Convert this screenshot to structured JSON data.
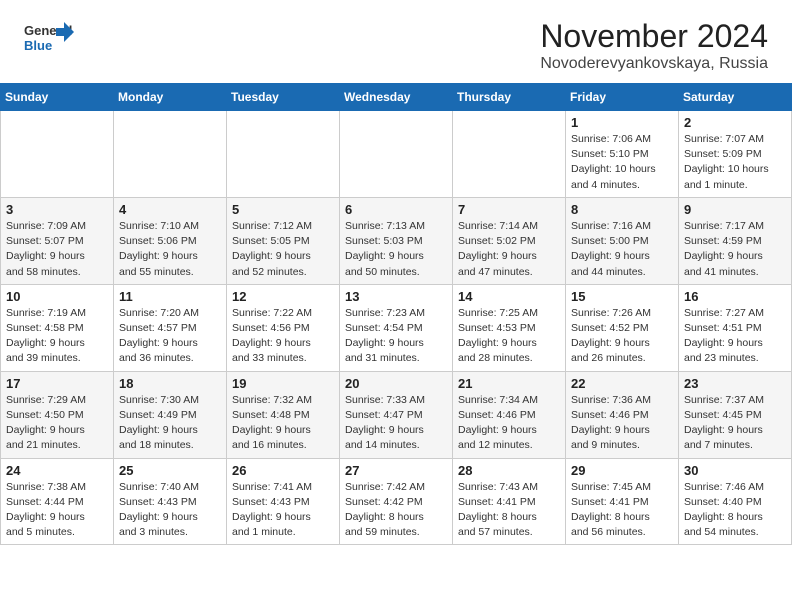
{
  "header": {
    "logo_line1": "General",
    "logo_line2": "Blue",
    "title": "November 2024",
    "subtitle": "Novoderevyankovskaya, Russia"
  },
  "days_of_week": [
    "Sunday",
    "Monday",
    "Tuesday",
    "Wednesday",
    "Thursday",
    "Friday",
    "Saturday"
  ],
  "weeks": [
    [
      {
        "day": "",
        "info": ""
      },
      {
        "day": "",
        "info": ""
      },
      {
        "day": "",
        "info": ""
      },
      {
        "day": "",
        "info": ""
      },
      {
        "day": "",
        "info": ""
      },
      {
        "day": "1",
        "info": "Sunrise: 7:06 AM\nSunset: 5:10 PM\nDaylight: 10 hours\nand 4 minutes."
      },
      {
        "day": "2",
        "info": "Sunrise: 7:07 AM\nSunset: 5:09 PM\nDaylight: 10 hours\nand 1 minute."
      }
    ],
    [
      {
        "day": "3",
        "info": "Sunrise: 7:09 AM\nSunset: 5:07 PM\nDaylight: 9 hours\nand 58 minutes."
      },
      {
        "day": "4",
        "info": "Sunrise: 7:10 AM\nSunset: 5:06 PM\nDaylight: 9 hours\nand 55 minutes."
      },
      {
        "day": "5",
        "info": "Sunrise: 7:12 AM\nSunset: 5:05 PM\nDaylight: 9 hours\nand 52 minutes."
      },
      {
        "day": "6",
        "info": "Sunrise: 7:13 AM\nSunset: 5:03 PM\nDaylight: 9 hours\nand 50 minutes."
      },
      {
        "day": "7",
        "info": "Sunrise: 7:14 AM\nSunset: 5:02 PM\nDaylight: 9 hours\nand 47 minutes."
      },
      {
        "day": "8",
        "info": "Sunrise: 7:16 AM\nSunset: 5:00 PM\nDaylight: 9 hours\nand 44 minutes."
      },
      {
        "day": "9",
        "info": "Sunrise: 7:17 AM\nSunset: 4:59 PM\nDaylight: 9 hours\nand 41 minutes."
      }
    ],
    [
      {
        "day": "10",
        "info": "Sunrise: 7:19 AM\nSunset: 4:58 PM\nDaylight: 9 hours\nand 39 minutes."
      },
      {
        "day": "11",
        "info": "Sunrise: 7:20 AM\nSunset: 4:57 PM\nDaylight: 9 hours\nand 36 minutes."
      },
      {
        "day": "12",
        "info": "Sunrise: 7:22 AM\nSunset: 4:56 PM\nDaylight: 9 hours\nand 33 minutes."
      },
      {
        "day": "13",
        "info": "Sunrise: 7:23 AM\nSunset: 4:54 PM\nDaylight: 9 hours\nand 31 minutes."
      },
      {
        "day": "14",
        "info": "Sunrise: 7:25 AM\nSunset: 4:53 PM\nDaylight: 9 hours\nand 28 minutes."
      },
      {
        "day": "15",
        "info": "Sunrise: 7:26 AM\nSunset: 4:52 PM\nDaylight: 9 hours\nand 26 minutes."
      },
      {
        "day": "16",
        "info": "Sunrise: 7:27 AM\nSunset: 4:51 PM\nDaylight: 9 hours\nand 23 minutes."
      }
    ],
    [
      {
        "day": "17",
        "info": "Sunrise: 7:29 AM\nSunset: 4:50 PM\nDaylight: 9 hours\nand 21 minutes."
      },
      {
        "day": "18",
        "info": "Sunrise: 7:30 AM\nSunset: 4:49 PM\nDaylight: 9 hours\nand 18 minutes."
      },
      {
        "day": "19",
        "info": "Sunrise: 7:32 AM\nSunset: 4:48 PM\nDaylight: 9 hours\nand 16 minutes."
      },
      {
        "day": "20",
        "info": "Sunrise: 7:33 AM\nSunset: 4:47 PM\nDaylight: 9 hours\nand 14 minutes."
      },
      {
        "day": "21",
        "info": "Sunrise: 7:34 AM\nSunset: 4:46 PM\nDaylight: 9 hours\nand 12 minutes."
      },
      {
        "day": "22",
        "info": "Sunrise: 7:36 AM\nSunset: 4:46 PM\nDaylight: 9 hours\nand 9 minutes."
      },
      {
        "day": "23",
        "info": "Sunrise: 7:37 AM\nSunset: 4:45 PM\nDaylight: 9 hours\nand 7 minutes."
      }
    ],
    [
      {
        "day": "24",
        "info": "Sunrise: 7:38 AM\nSunset: 4:44 PM\nDaylight: 9 hours\nand 5 minutes."
      },
      {
        "day": "25",
        "info": "Sunrise: 7:40 AM\nSunset: 4:43 PM\nDaylight: 9 hours\nand 3 minutes."
      },
      {
        "day": "26",
        "info": "Sunrise: 7:41 AM\nSunset: 4:43 PM\nDaylight: 9 hours\nand 1 minute."
      },
      {
        "day": "27",
        "info": "Sunrise: 7:42 AM\nSunset: 4:42 PM\nDaylight: 8 hours\nand 59 minutes."
      },
      {
        "day": "28",
        "info": "Sunrise: 7:43 AM\nSunset: 4:41 PM\nDaylight: 8 hours\nand 57 minutes."
      },
      {
        "day": "29",
        "info": "Sunrise: 7:45 AM\nSunset: 4:41 PM\nDaylight: 8 hours\nand 56 minutes."
      },
      {
        "day": "30",
        "info": "Sunrise: 7:46 AM\nSunset: 4:40 PM\nDaylight: 8 hours\nand 54 minutes."
      }
    ]
  ]
}
